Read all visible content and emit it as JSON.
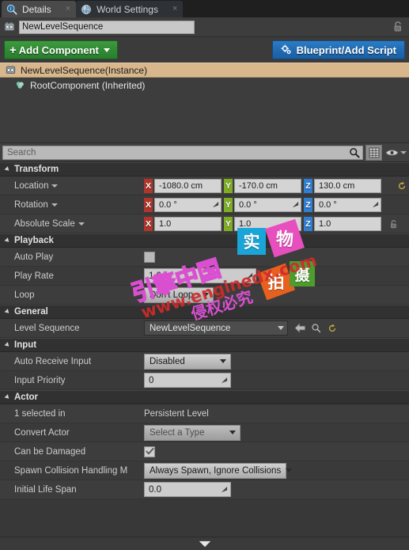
{
  "tabs": [
    {
      "label": "Details",
      "icon": "details-magnifier-icon",
      "active": true,
      "close": "×"
    },
    {
      "label": "World Settings",
      "icon": "globe-icon",
      "active": false,
      "close": "×"
    }
  ],
  "name_row": {
    "icon": "level-sequence-icon",
    "value": "NewLevelSequence",
    "placeholder": "Name",
    "lock_icon": "lock-open-icon"
  },
  "toolbar": {
    "add_component_label": "Add Component",
    "add_component_plus": "+",
    "blueprint_label": "Blueprint/Add Script",
    "blueprint_icon": "blueprint-gears-icon"
  },
  "component_tree": [
    {
      "label": "NewLevelSequence(Instance)",
      "icon": "level-sequence-icon",
      "selected": true
    },
    {
      "label": "RootComponent (Inherited)",
      "icon": "scene-component-icon",
      "selected": false
    }
  ],
  "search": {
    "placeholder": "Search",
    "value": "",
    "search_icon": "magnifier-icon",
    "grid_icon": "grid-view-icon",
    "eye_icon": "eye-icon",
    "eye_caret": "chevron-down-icon"
  },
  "sections": {
    "transform": {
      "title": "Transform",
      "rows": [
        {
          "label": "Location",
          "has_caret": true,
          "type": "vector",
          "axes": [
            {
              "axis": "X",
              "value": "-1080.0 cm",
              "color": "#b2352c"
            },
            {
              "axis": "Y",
              "value": "-170.0 cm",
              "color": "#7fae26"
            },
            {
              "axis": "Z",
              "value": "130.0 cm",
              "color": "#2f7fd4"
            }
          ],
          "trailing_icon": "reset-arrow-icon",
          "has_spinner": false
        },
        {
          "label": "Rotation",
          "has_caret": true,
          "type": "vector",
          "axes": [
            {
              "axis": "X",
              "value": "0.0 °",
              "color": "#b2352c"
            },
            {
              "axis": "Y",
              "value": "0.0 °",
              "color": "#7fae26"
            },
            {
              "axis": "Z",
              "value": "0.0 °",
              "color": "#2f7fd4"
            }
          ],
          "trailing_icon": "",
          "has_spinner": true
        },
        {
          "label": "Absolute Scale",
          "has_caret": true,
          "type": "vector",
          "axes": [
            {
              "axis": "X",
              "value": "1.0",
              "color": "#b2352c"
            },
            {
              "axis": "Y",
              "value": "1.0",
              "color": "#7fae26"
            },
            {
              "axis": "Z",
              "value": "1.0",
              "color": "#2f7fd4"
            }
          ],
          "trailing_icon": "lock-ratio-icon",
          "has_spinner": false
        }
      ]
    },
    "playback": {
      "title": "Playback",
      "auto_play": {
        "label": "Auto Play",
        "checked": false
      },
      "play_rate": {
        "label": "Play Rate",
        "value": "1.0"
      },
      "loop": {
        "label": "Loop",
        "value": "Don't Loop"
      }
    },
    "general": {
      "title": "General",
      "level_sequence": {
        "label": "Level Sequence",
        "value": "NewLevelSequence",
        "icons": [
          "use-selected-arrow-icon",
          "browse-magnifier-icon",
          "reset-arrow-icon"
        ]
      }
    },
    "input": {
      "title": "Input",
      "auto_receive_input": {
        "label": "Auto Receive Input",
        "value": "Disabled"
      },
      "input_priority": {
        "label": "Input Priority",
        "value": "0"
      }
    },
    "actor": {
      "title": "Actor",
      "selected_in": {
        "label": "1 selected in",
        "value": "Persistent Level"
      },
      "convert_actor": {
        "label": "Convert Actor",
        "value": "Select a Type"
      },
      "can_be_damaged": {
        "label": "Can be Damaged",
        "checked": true
      },
      "spawn_collision": {
        "label": "Spawn Collision Handling M",
        "value": "Always Spawn, Ignore Collisions"
      },
      "initial_life_span": {
        "label": "Initial Life Span",
        "value": "0.0"
      }
    }
  },
  "footer": {
    "scroll_icon": "scroll-down-icon"
  },
  "watermarks": {
    "brand_outline": "引擎中国",
    "url": "www.enginedx.com",
    "rights": "侵权必究",
    "tag_shi": "实",
    "tag_wu": "物",
    "tag_pai": "拍",
    "tag_she": "摄",
    "colors": {
      "cyan": "#1aa5d8",
      "magenta": "#e84fbe",
      "orange": "#e8601f",
      "green": "#4e9b2e",
      "outline_pink": "#d94fd0",
      "red": "#cf2b2b"
    }
  }
}
